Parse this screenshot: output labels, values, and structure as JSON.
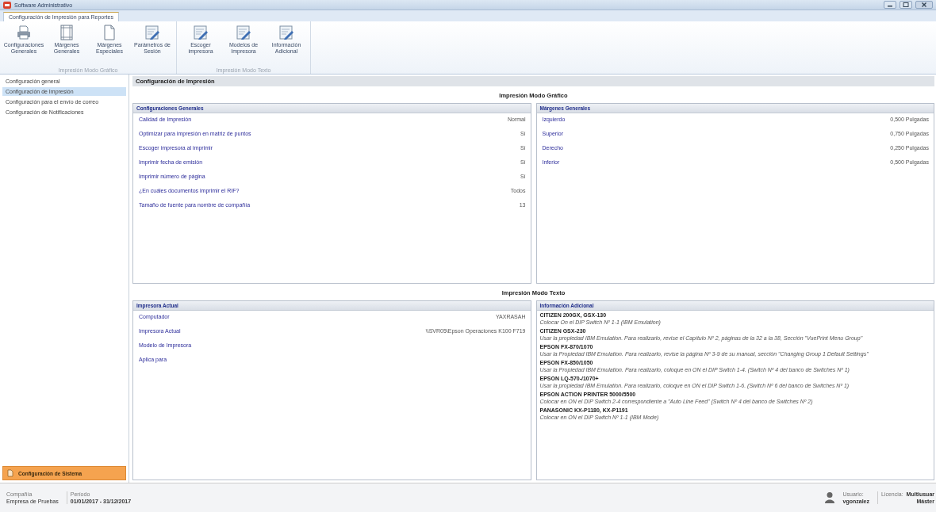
{
  "window": {
    "title": "Software Administrativo"
  },
  "tabs": [
    {
      "label": "Configuración de Impresión para Reportes",
      "selected": true
    }
  ],
  "ribbon": {
    "groups": [
      {
        "label": "Impresión Modo Gráfico",
        "buttons": [
          {
            "label": "Configuraciones Generales",
            "kind": "printer"
          },
          {
            "label": "Márgenes Generales",
            "kind": "margins"
          },
          {
            "label": "Márgenes Especiales",
            "kind": "page"
          },
          {
            "label": "Parámetros de Sesión",
            "kind": "edit"
          }
        ]
      },
      {
        "label": "Impresión Modo Texto",
        "buttons": [
          {
            "label": "Escoger impresora",
            "kind": "edit"
          },
          {
            "label": "Modelos de Impresora",
            "kind": "edit"
          },
          {
            "label": "Información Adicional",
            "kind": "edit"
          }
        ]
      }
    ]
  },
  "sidebar": {
    "items": [
      {
        "label": "Configuración general",
        "selected": false
      },
      {
        "label": "Configuración de Impresión",
        "selected": true
      },
      {
        "label": "Configuración para el envío de correo",
        "selected": false
      },
      {
        "label": "Configuración de Notificaciones",
        "selected": false
      }
    ],
    "footer_button": "Configuración de Sistema"
  },
  "main": {
    "header": "Configuración de Impresión",
    "sections": [
      {
        "title": "Impresión Modo Gráfico",
        "panels": [
          {
            "title": "Configuraciones Generales",
            "kind": "properties",
            "rows": [
              {
                "label": "Calidad de Impresión",
                "value": "Normal"
              },
              {
                "label": "Optimizar para impresión en matriz de puntos",
                "value": "Sí"
              },
              {
                "label": "Escoger impresora al imprimir",
                "value": "Sí"
              },
              {
                "label": "Imprimir fecha de emisión",
                "value": "Sí"
              },
              {
                "label": "Imprimir número de página",
                "value": "Sí"
              },
              {
                "label": "¿En cuáles documentos imprimir el RIF?",
                "value": "Todos"
              },
              {
                "label": "Tamaño de fuente para nombre de compañía",
                "value": "13"
              }
            ]
          },
          {
            "title": "Márgenes Generales",
            "kind": "properties",
            "rows": [
              {
                "label": "Izquierdo",
                "value": "0,500 Pulgadas"
              },
              {
                "label": "Superior",
                "value": "0,750 Pulgadas"
              },
              {
                "label": "Derecho",
                "value": "0,250 Pulgadas"
              },
              {
                "label": "Inferior",
                "value": "0,500 Pulgadas"
              }
            ]
          }
        ]
      },
      {
        "title": "Impresión Modo Texto",
        "panels": [
          {
            "title": "Impresora Actual",
            "kind": "properties",
            "rows": [
              {
                "label": "Computador",
                "value": "YAXRASAH"
              },
              {
                "label": "Impresora Actual",
                "value": "\\\\SVR05\\Epson Operaciones K100 F719"
              },
              {
                "label": "Modelo de Impresora"
              },
              {
                "label": "Aplica para"
              }
            ]
          },
          {
            "title": "Información Adicional",
            "kind": "notes",
            "rows": [
              {
                "label": "CITIZEN 200GX, GSX-130",
                "value": "Colocar On el DIP Switch Nº 1-1 (IBM Emulation)"
              },
              {
                "label": "CITIZEN GSX-230",
                "value": "Usar la propiedad IBM Emulation. Para realizarlo, revise el Capítulo Nº 2, páginas de la 32 a la 38, Sección \"VuePrint Menu Group\""
              },
              {
                "label": "EPSON FX-870/1070",
                "value": "Usar la Propiedad IBM Emulation. Para realizarlo, revise la página Nº 3-9 de su manual, sección \"Changing Group 1 Default Settings\""
              },
              {
                "label": "EPSON FX-850/1050",
                "value": "Usar la Propiedad IBM Emulation. Para realizarlo, coloque en ON el DIP Switch 1-4. (Switch Nº 4 del banco de Switches Nº 1)"
              },
              {
                "label": "EPSON LQ-570-/1070+",
                "value": "Usar la propiedad IBM Emulation. Para realizarlo, coloque en ON el DIP Switch 1-6. (Switch Nº 6 del banco de Switches Nº 1)"
              },
              {
                "label": "EPSON ACTION PRINTER 5000/5500",
                "value": "Colocar en ON el DIP Switch 2-4 correspondiente a \"Auto Line Feed\" (Switch Nº 4 del banco de Switches Nº 2)"
              },
              {
                "label": "PANASONIC KX-P1180, KX-P1191",
                "value": "Colocar en ON el DIP Switch Nº 1-1 (IBM Mode)"
              }
            ]
          }
        ]
      }
    ]
  },
  "status_bar": {
    "company_label": "Compañía",
    "company": "Empresa de Pruebas",
    "period_label": "Período",
    "period": "01/01/2017 - 31/12/2017",
    "user_label": "Usuario:",
    "user": "vgonzalez",
    "license_label": "Licencia:",
    "license": "Multiusuar",
    "license_type": "Máster"
  }
}
